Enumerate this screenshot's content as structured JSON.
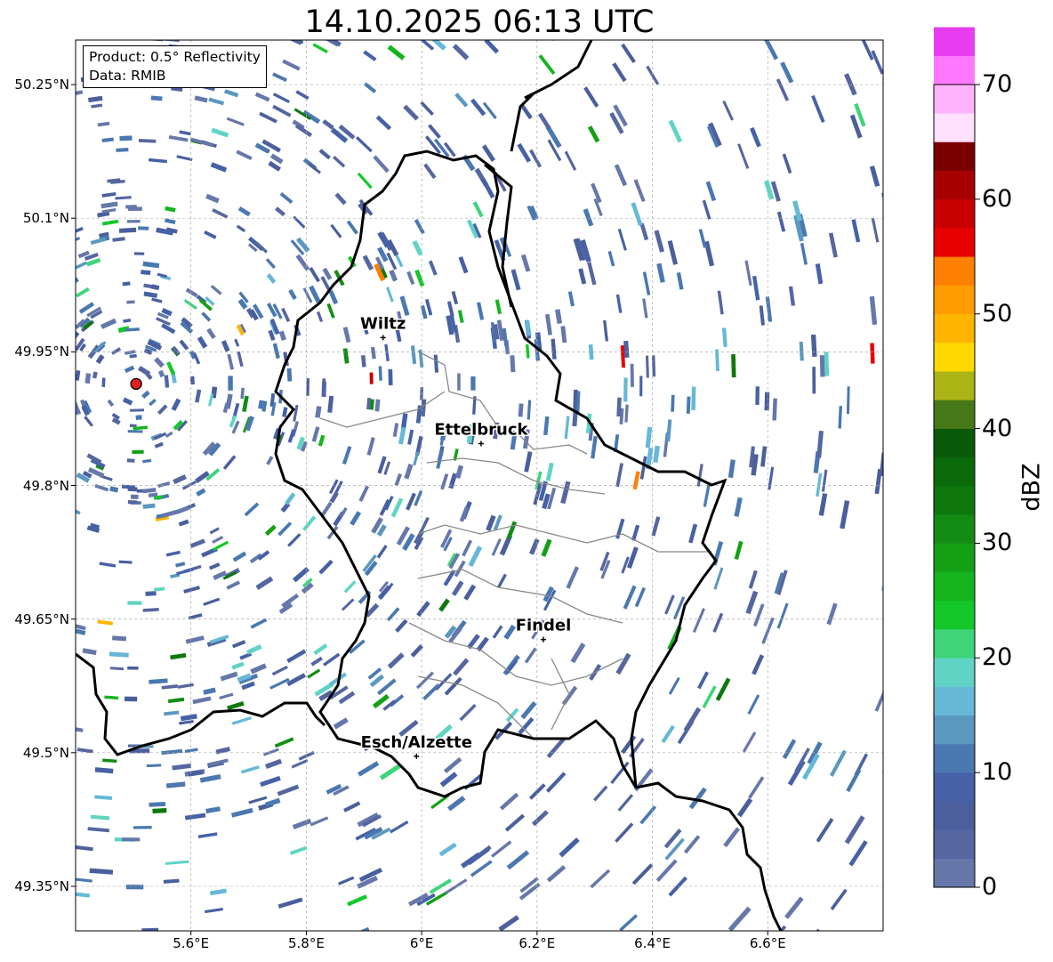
{
  "title": "14.10.2025 06:13 UTC",
  "info_box": {
    "product": "Product: 0.5° Reflectivity",
    "data": "Data: RMIB"
  },
  "map": {
    "lat_labels": [
      "50.25°N",
      "50.1°N",
      "49.95°N",
      "49.8°N",
      "49.65°N",
      "49.5°N",
      "49.35°N"
    ],
    "lon_labels": [
      "5.6°E",
      "5.8°E",
      "6°E",
      "6.2°E",
      "6.4°E",
      "6.6°E"
    ],
    "lat_values": [
      50.25,
      50.1,
      49.95,
      49.8,
      49.65,
      49.5,
      49.35
    ],
    "lon_values": [
      5.6,
      5.8,
      6.0,
      6.2,
      6.4,
      6.6
    ],
    "extent": {
      "lon_min": 5.4,
      "lon_max": 6.8,
      "lat_min": 49.3,
      "lat_max": 50.3
    },
    "radar_site": {
      "lon": 5.505,
      "lat": 49.914
    },
    "cities": [
      {
        "name": "Wiltz",
        "lon": 5.933,
        "lat": 49.966
      },
      {
        "name": "Ettelbruck",
        "lon": 6.103,
        "lat": 49.847
      },
      {
        "name": "Findel",
        "lon": 6.211,
        "lat": 49.627
      },
      {
        "name": "Esch/Alzette",
        "lon": 5.991,
        "lat": 49.496
      }
    ]
  },
  "colorbar": {
    "label": "dBZ",
    "tick_labels": [
      "0",
      "10",
      "20",
      "30",
      "40",
      "50",
      "60",
      "70"
    ],
    "tick_values": [
      0,
      10,
      20,
      30,
      40,
      50,
      60,
      70
    ],
    "range": [
      0,
      70
    ],
    "step": 2.5,
    "colors": [
      "#6677aa",
      "#5566a0",
      "#4a5f9c",
      "#4661a6",
      "#4a78b0",
      "#5a98c0",
      "#66b8d6",
      "#5fd4c4",
      "#3ed47a",
      "#14c82a",
      "#14b41e",
      "#14a014",
      "#148c14",
      "#0e780e",
      "#0a6a0a",
      "#0a5a0a",
      "#467818",
      "#aab414",
      "#ffd800",
      "#ffb400",
      "#ff9c00",
      "#ff8000",
      "#e80000",
      "#c80000",
      "#a80000",
      "#7a0000",
      "#ffe0ff",
      "#ffb4ff",
      "#ff78ff",
      "#e83cf0"
    ]
  },
  "chart_data": {
    "type": "heatmap",
    "title": "14.10.2025 06:13 UTC",
    "product": "0.5° Reflectivity",
    "source": "RMIB",
    "colorbar_label": "dBZ",
    "value_range": [
      0,
      70
    ],
    "xlim": [
      5.4,
      6.8
    ],
    "ylim": [
      49.3,
      50.3
    ]
  }
}
